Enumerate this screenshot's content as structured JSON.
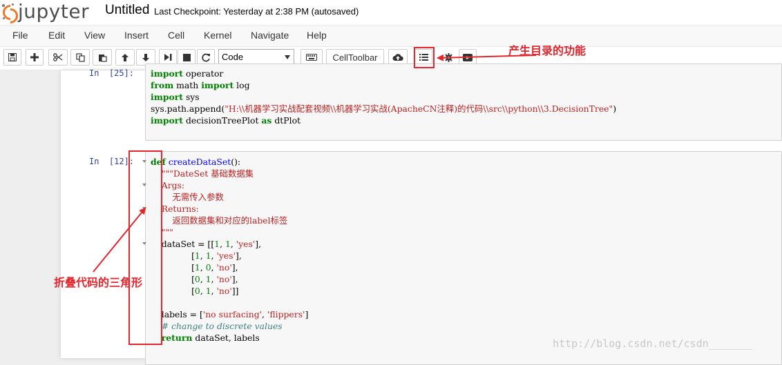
{
  "header": {
    "logo_text": "jupyter",
    "notebook_name": "Untitled",
    "checkpoint": "Last Checkpoint: Yesterday at 2:38 PM (autosaved)"
  },
  "menu": [
    "File",
    "Edit",
    "View",
    "Insert",
    "Cell",
    "Kernel",
    "Navigate",
    "Help"
  ],
  "toolbar": {
    "cell_type": "Code",
    "celltoolbar_label": "CellToolbar",
    "icons": [
      "save-icon",
      "plus-icon",
      "scissors-icon",
      "copy-icon",
      "paste-icon",
      "arrow-up-icon",
      "arrow-down-icon",
      "step-forward-icon",
      "stop-icon",
      "refresh-icon",
      "keyboard-icon",
      "cloud-upload-icon",
      "list-icon",
      "gear-icon",
      "video-icon"
    ]
  },
  "cells": [
    {
      "prompt": "In  [25]:",
      "lines": [
        [
          [
            "kw",
            "import"
          ],
          [
            "p",
            " operator"
          ]
        ],
        [
          [
            "kw",
            "from"
          ],
          [
            "p",
            " math "
          ],
          [
            "kw",
            "import"
          ],
          [
            "p",
            " log"
          ]
        ],
        [
          [
            "kw",
            "import"
          ],
          [
            "p",
            " sys"
          ]
        ],
        [
          [
            "p",
            "sys.path.append("
          ],
          [
            "str",
            "\"H:\\\\机器学习实战配套视频\\\\机器学习实战(ApacheCN注释)的代码\\\\src\\\\python\\\\3.DecisionTree\""
          ],
          [
            "p",
            ")"
          ]
        ],
        [
          [
            "kw",
            "import"
          ],
          [
            "p",
            " decisionTreePlot "
          ],
          [
            "kw",
            "as"
          ],
          [
            "p",
            " dtPlot"
          ]
        ]
      ]
    },
    {
      "prompt": "In  [12]:",
      "lines": [
        [
          [
            "kw",
            "def"
          ],
          [
            "p",
            " "
          ],
          [
            "fn",
            "createDataSet"
          ],
          [
            "p",
            "():"
          ]
        ],
        [
          [
            "str",
            "    \"\"\"DateSet 基础数据集"
          ]
        ],
        [
          [
            "str",
            "    Args:"
          ]
        ],
        [
          [
            "str",
            "        无需传入参数"
          ]
        ],
        [
          [
            "str",
            "    Returns:"
          ]
        ],
        [
          [
            "str",
            "        返回数据集和对应的label标签"
          ]
        ],
        [
          [
            "str",
            "    \"\"\""
          ]
        ],
        [
          [
            "p",
            "    dataSet = [["
          ],
          [
            "num",
            "1"
          ],
          [
            "p",
            ", "
          ],
          [
            "num",
            "1"
          ],
          [
            "p",
            ", "
          ],
          [
            "str",
            "'yes'"
          ],
          [
            "p",
            "],"
          ]
        ],
        [
          [
            "p",
            "               ["
          ],
          [
            "num",
            "1"
          ],
          [
            "p",
            ", "
          ],
          [
            "num",
            "1"
          ],
          [
            "p",
            ", "
          ],
          [
            "str",
            "'yes'"
          ],
          [
            "p",
            "],"
          ]
        ],
        [
          [
            "p",
            "               ["
          ],
          [
            "num",
            "1"
          ],
          [
            "p",
            ", "
          ],
          [
            "num",
            "0"
          ],
          [
            "p",
            ", "
          ],
          [
            "str",
            "'no'"
          ],
          [
            "p",
            "],"
          ]
        ],
        [
          [
            "p",
            "               ["
          ],
          [
            "num",
            "0"
          ],
          [
            "p",
            ", "
          ],
          [
            "num",
            "1"
          ],
          [
            "p",
            ", "
          ],
          [
            "str",
            "'no'"
          ],
          [
            "p",
            "],"
          ]
        ],
        [
          [
            "p",
            "               ["
          ],
          [
            "num",
            "0"
          ],
          [
            "p",
            ", "
          ],
          [
            "num",
            "1"
          ],
          [
            "p",
            ", "
          ],
          [
            "str",
            "'no'"
          ],
          [
            "p",
            "]]"
          ]
        ],
        [
          [
            "p",
            ""
          ]
        ],
        [
          [
            "p",
            "    labels = ["
          ],
          [
            "str",
            "'no surfacing'"
          ],
          [
            "p",
            ", "
          ],
          [
            "str",
            "'flippers'"
          ],
          [
            "p",
            "]"
          ]
        ],
        [
          [
            "cmt",
            "    # change to discrete values"
          ]
        ],
        [
          [
            "p",
            "    "
          ],
          [
            "kw",
            "return"
          ],
          [
            "p",
            " dataSet, labels"
          ]
        ]
      ]
    }
  ],
  "annotations": {
    "toc_label": "产生目录的功能",
    "fold_label": "折叠代码的三角形"
  },
  "watermark": "http://blog.csdn.net/csdn_______",
  "colors": {
    "annotation_red": "#e5242b",
    "logo_orange": "#f37626",
    "prompt_blue": "#303f9f"
  }
}
